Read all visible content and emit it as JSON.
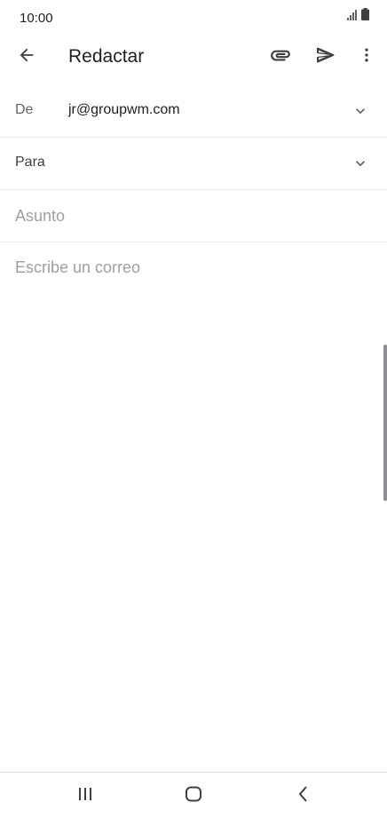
{
  "status_bar": {
    "time": "10:00",
    "icons": [
      "signal-icon",
      "battery-icon"
    ]
  },
  "app_bar": {
    "title": "Redactar",
    "icons": [
      "back-arrow-icon",
      "attachment-icon",
      "send-icon",
      "more-vert-icon"
    ]
  },
  "compose": {
    "from_label": "De",
    "from_value": "jr@groupwm.com",
    "to_label": "Para",
    "subject_placeholder": "Asunto",
    "body_placeholder": "Escribe un correo"
  },
  "nav_bar": {
    "icons": [
      "recents-icon",
      "home-icon",
      "back-icon"
    ]
  },
  "colors": {
    "text_primary": "#202124",
    "text_secondary": "#5f6368",
    "placeholder": "#9aa0a6",
    "divider": "#ececec"
  }
}
